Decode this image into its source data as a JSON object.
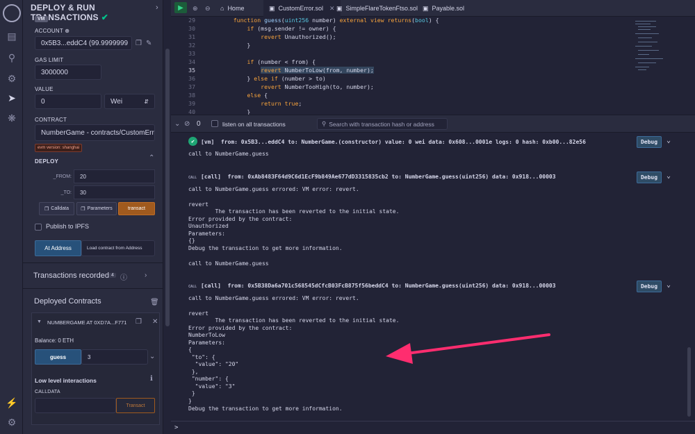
{
  "panel": {
    "title": "DEPLOY & RUN TRANSACTIONS",
    "vm_badge": "VM",
    "account_label": "ACCOUNT",
    "account_value": "0x5B3...eddC4 (99.9999999",
    "gas_limit_label": "GAS LIMIT",
    "gas_limit_value": "3000000",
    "value_label": "VALUE",
    "value_value": "0",
    "value_unit": "Wei",
    "contract_label": "CONTRACT",
    "contract_value": "NumberGame - contracts/CustomErro",
    "evm_version": "evm version: shanghai",
    "deploy_label": "DEPLOY",
    "params": [
      {
        "name": "_FROM:",
        "value": "20"
      },
      {
        "name": "_TO:",
        "value": "30"
      }
    ],
    "calldata_btn": "Calldata",
    "parameters_btn": "Parameters",
    "transact_btn": "transact",
    "publish_ipfs": "Publish to IPFS",
    "at_address_btn": "At Address",
    "load_contract": "Load contract from Address",
    "tx_recorded": "Transactions recorded",
    "tx_count": "4",
    "deployed_contracts": "Deployed Contracts",
    "instance_name": "NUMBERGAME AT 0XD7A...F771",
    "balance": "Balance: 0 ETH",
    "guess_btn": "guess",
    "guess_value": "3",
    "low_level": "Low level interactions",
    "calldata_label": "CALLDATA",
    "low_transact": "Transact"
  },
  "tabs": [
    {
      "label": "Home",
      "icon": "home-icon"
    },
    {
      "label": "CustomError.sol",
      "icon": "file-icon",
      "active": true
    },
    {
      "label": "SimpleFlareTokenFtso.sol",
      "icon": "file-icon"
    },
    {
      "label": "Payable.sol",
      "icon": "file-icon"
    }
  ],
  "code": [
    {
      "n": "29",
      "text": "    function guess(uint256 number) external view returns(bool) {"
    },
    {
      "n": "30",
      "text": "        if (msg.sender != owner) {"
    },
    {
      "n": "31",
      "text": "            revert Unauthorized();"
    },
    {
      "n": "32",
      "text": "        }"
    },
    {
      "n": "33",
      "text": ""
    },
    {
      "n": "34",
      "text": "        if (number < from) {"
    },
    {
      "n": "35",
      "text": "            revert NumberToLow(from, number);"
    },
    {
      "n": "36",
      "text": "        } else if (number > to)"
    },
    {
      "n": "37",
      "text": "            revert NumberTooHigh(to, number);"
    },
    {
      "n": "38",
      "text": "        else {"
    },
    {
      "n": "39",
      "text": "            return true;"
    },
    {
      "n": "40",
      "text": "        }"
    }
  ],
  "terminal": {
    "pending_count": "0",
    "listen_label": "listen on all transactions",
    "search_placeholder": "Search with transaction hash or address",
    "debug_label": "Debug",
    "entry1": "[vm]  from: 0x5B3...eddC4 to: NumberGame.(constructor) value: 0 wei data: 0x608...0001e logs: 0 hash: 0xb00...82e56",
    "entry1_call": "call to NumberGame.guess",
    "call_badge": "CALL",
    "entry2": "[call]  from: 0xAb8483F64d9C6d1EcF9b849Ae677dD3315835cb2 to: NumberGame.guess(uint256) data: 0x918...00003",
    "entry2_lines": [
      "call to NumberGame.guess errored: VM error: revert.",
      "",
      "revert",
      "        The transaction has been reverted to the initial state.",
      "Error provided by the contract:",
      "Unauthorized",
      "Parameters:",
      "{}",
      "Debug the transaction to get more information.",
      "",
      "call to NumberGame.guess"
    ],
    "entry3": "[call]  from: 0x5B38Da6a701c568545dCfcB03FcB875f56beddC4 to: NumberGame.guess(uint256) data: 0x918...00003",
    "entry3_lines": [
      "call to NumberGame.guess errored: VM error: revert.",
      "",
      "revert",
      "        The transaction has been reverted to the initial state.",
      "Error provided by the contract:",
      "NumberToLow",
      "Parameters:",
      "{",
      " \"to\": {",
      "  \"value\": \"20\"",
      " },",
      " \"number\": {",
      "  \"value\": \"3\"",
      " }",
      "}",
      "Debug the transaction to get more information."
    ],
    "prompt": ">"
  },
  "colors": {
    "accent": "#ff2d6f",
    "orange": "#a05a1e",
    "blue": "#27517a"
  }
}
